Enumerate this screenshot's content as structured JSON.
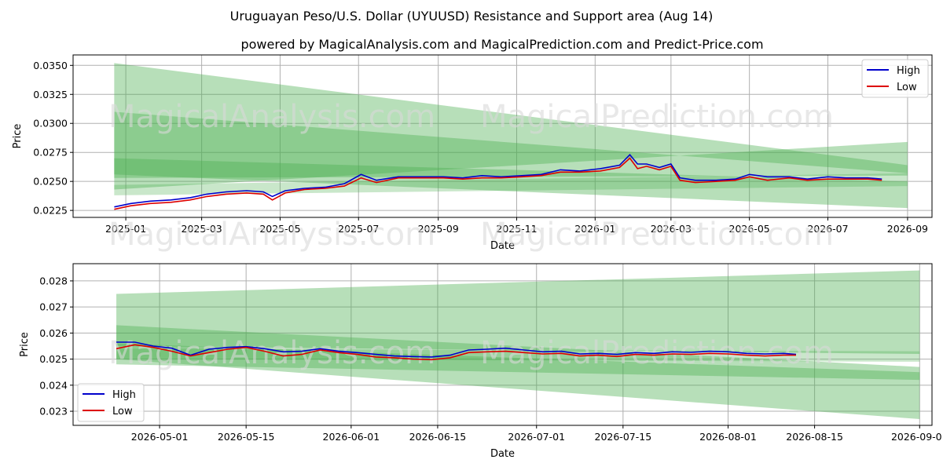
{
  "title": "Uruguayan Peso/U.S. Dollar (UYUUSD) Resistance and Support area (Aug 14)",
  "subtitle": "powered by MagicalAnalysis.com and MagicalPrediction.com and Predict-Price.com",
  "watermarks": [
    "MagicalAnalysis.com",
    "MagicalPrediction.com"
  ],
  "colors": {
    "high": "#0000cc",
    "low": "#dd0000",
    "band": "#4caf50",
    "grid": "#b0b0b0"
  },
  "chart_data": [
    {
      "type": "line",
      "xlabel": "Date",
      "ylabel": "Price",
      "xlim": [
        "2024-11-21",
        "2026-09-20"
      ],
      "ylim": [
        0.0219,
        0.0359
      ],
      "grid": true,
      "legend": "top-right",
      "x_ticks": [
        {
          "date": "2025-01-01",
          "label": "2025-01"
        },
        {
          "date": "2025-03-01",
          "label": "2025-03"
        },
        {
          "date": "2025-05-01",
          "label": "2025-05"
        },
        {
          "date": "2025-07-01",
          "label": "2025-07"
        },
        {
          "date": "2025-09-01",
          "label": "2025-09"
        },
        {
          "date": "2025-11-01",
          "label": "2025-11"
        },
        {
          "date": "2026-01-01",
          "label": "2026-01"
        },
        {
          "date": "2026-03-01",
          "label": "2026-03"
        },
        {
          "date": "2026-05-01",
          "label": "2026-05"
        },
        {
          "date": "2026-07-01",
          "label": "2026-07"
        },
        {
          "date": "2026-09-01",
          "label": "2026-09"
        }
      ],
      "y_ticks": [
        {
          "value": 0.0225,
          "label": "0.0225"
        },
        {
          "value": 0.025,
          "label": "0.0250"
        },
        {
          "value": 0.0275,
          "label": "0.0275"
        },
        {
          "value": 0.03,
          "label": "0.0300"
        },
        {
          "value": 0.0325,
          "label": "0.0325"
        },
        {
          "value": 0.035,
          "label": "0.0350"
        }
      ],
      "bands": [
        {
          "x": [
            "2024-12-23",
            "2026-09-01"
          ],
          "upper": [
            0.0352,
            0.0264
          ],
          "lower": [
            0.0253,
            0.0255
          ],
          "opacity": 0.4
        },
        {
          "x": [
            "2024-12-23",
            "2026-09-01"
          ],
          "upper": [
            0.031,
            0.0257
          ],
          "lower": [
            0.0243,
            0.0284
          ],
          "opacity": 0.4
        },
        {
          "x": [
            "2024-12-23",
            "2026-09-01"
          ],
          "upper": [
            0.027,
            0.025
          ],
          "lower": [
            0.0256,
            0.0227
          ],
          "opacity": 0.4
        },
        {
          "x": [
            "2024-12-23",
            "2026-09-01"
          ],
          "upper": [
            0.0247,
            0.0257
          ],
          "lower": [
            0.0238,
            0.0246
          ],
          "opacity": 0.3
        }
      ],
      "series": [
        {
          "name": "High",
          "x": [
            "2024-12-23",
            "2025-01-05",
            "2025-01-20",
            "2025-02-05",
            "2025-02-20",
            "2025-03-05",
            "2025-03-20",
            "2025-04-05",
            "2025-04-18",
            "2025-04-25",
            "2025-05-05",
            "2025-05-20",
            "2025-06-05",
            "2025-06-20",
            "2025-07-03",
            "2025-07-15",
            "2025-08-01",
            "2025-08-20",
            "2025-09-05",
            "2025-09-20",
            "2025-10-05",
            "2025-10-20",
            "2025-11-05",
            "2025-11-20",
            "2025-12-05",
            "2025-12-20",
            "2026-01-05",
            "2026-01-20",
            "2026-01-28",
            "2026-02-03",
            "2026-02-10",
            "2026-02-20",
            "2026-03-01",
            "2026-03-08",
            "2026-03-20",
            "2026-04-05",
            "2026-04-20",
            "2026-05-01",
            "2026-05-15",
            "2026-06-01",
            "2026-06-15",
            "2026-07-01",
            "2026-07-15",
            "2026-08-01",
            "2026-08-12"
          ],
          "values": [
            0.0228,
            0.0231,
            0.0233,
            0.0234,
            0.0236,
            0.0239,
            0.0241,
            0.0242,
            0.0241,
            0.0237,
            0.0242,
            0.0244,
            0.0245,
            0.0248,
            0.0256,
            0.0251,
            0.0254,
            0.0254,
            0.0254,
            0.0253,
            0.0255,
            0.0254,
            0.0255,
            0.0256,
            0.026,
            0.0259,
            0.0261,
            0.0264,
            0.0273,
            0.0265,
            0.0265,
            0.0262,
            0.0265,
            0.0253,
            0.0251,
            0.0251,
            0.0252,
            0.0256,
            0.0254,
            0.0254,
            0.0252,
            0.0254,
            0.0253,
            0.0253,
            0.0252
          ]
        },
        {
          "name": "Low",
          "x": [
            "2024-12-23",
            "2025-01-05",
            "2025-01-20",
            "2025-02-05",
            "2025-02-20",
            "2025-03-05",
            "2025-03-20",
            "2025-04-05",
            "2025-04-18",
            "2025-04-25",
            "2025-05-05",
            "2025-05-20",
            "2025-06-05",
            "2025-06-20",
            "2025-07-03",
            "2025-07-15",
            "2025-08-01",
            "2025-08-20",
            "2025-09-05",
            "2025-09-20",
            "2025-10-05",
            "2025-10-20",
            "2025-11-05",
            "2025-11-20",
            "2025-12-05",
            "2025-12-20",
            "2026-01-05",
            "2026-01-20",
            "2026-01-28",
            "2026-02-03",
            "2026-02-10",
            "2026-02-20",
            "2026-03-01",
            "2026-03-08",
            "2026-03-20",
            "2026-04-05",
            "2026-04-20",
            "2026-05-01",
            "2026-05-15",
            "2026-06-01",
            "2026-06-15",
            "2026-07-01",
            "2026-07-15",
            "2026-08-01",
            "2026-08-12"
          ],
          "values": [
            0.0226,
            0.0229,
            0.0231,
            0.0232,
            0.0234,
            0.0237,
            0.0239,
            0.024,
            0.0239,
            0.0234,
            0.024,
            0.0243,
            0.0244,
            0.0246,
            0.0253,
            0.0249,
            0.0253,
            0.0253,
            0.0253,
            0.0252,
            0.0253,
            0.0253,
            0.0254,
            0.0255,
            0.0258,
            0.0258,
            0.0259,
            0.0262,
            0.027,
            0.0261,
            0.0263,
            0.026,
            0.0263,
            0.0251,
            0.0249,
            0.025,
            0.0251,
            0.0254,
            0.0251,
            0.0253,
            0.0251,
            0.0252,
            0.0252,
            0.0252,
            0.0251
          ]
        }
      ]
    },
    {
      "type": "line",
      "xlabel": "Date",
      "ylabel": "Price",
      "xlim": [
        "2026-04-17",
        "2026-09-03"
      ],
      "ylim": [
        0.02246,
        0.02866
      ],
      "grid": true,
      "legend": "bottom-left",
      "x_ticks": [
        {
          "date": "2026-05-01",
          "label": "2026-05-01"
        },
        {
          "date": "2026-05-15",
          "label": "2026-05-15"
        },
        {
          "date": "2026-06-01",
          "label": "2026-06-01"
        },
        {
          "date": "2026-06-15",
          "label": "2026-06-15"
        },
        {
          "date": "2026-07-01",
          "label": "2026-07-01"
        },
        {
          "date": "2026-07-15",
          "label": "2026-07-15"
        },
        {
          "date": "2026-08-01",
          "label": "2026-08-01"
        },
        {
          "date": "2026-08-15",
          "label": "2026-08-15"
        },
        {
          "date": "2026-09-01",
          "label": "2026-09-01"
        }
      ],
      "y_ticks": [
        {
          "value": 0.023,
          "label": "0.023"
        },
        {
          "value": 0.024,
          "label": "0.024"
        },
        {
          "value": 0.025,
          "label": "0.025"
        },
        {
          "value": 0.026,
          "label": "0.026"
        },
        {
          "value": 0.027,
          "label": "0.027"
        },
        {
          "value": 0.028,
          "label": "0.028"
        }
      ],
      "bands": [
        {
          "x": [
            "2026-04-24",
            "2026-09-01"
          ],
          "upper": [
            0.0275,
            0.0284
          ],
          "lower": [
            0.0255,
            0.0252
          ],
          "opacity": 0.4
        },
        {
          "x": [
            "2026-04-24",
            "2026-09-01"
          ],
          "upper": [
            0.0263,
            0.0247
          ],
          "lower": [
            0.025,
            0.0227
          ],
          "opacity": 0.4
        },
        {
          "x": [
            "2026-04-24",
            "2026-09-01"
          ],
          "upper": [
            0.0256,
            0.0245
          ],
          "lower": [
            0.0248,
            0.0242
          ],
          "opacity": 0.4
        },
        {
          "x": [
            "2026-04-24",
            "2026-09-01"
          ],
          "upper": [
            0.0254,
            0.0253
          ],
          "lower": [
            0.025,
            0.0249
          ],
          "opacity": 0.3
        }
      ],
      "series": [
        {
          "name": "High",
          "x": [
            "2026-04-24",
            "2026-04-27",
            "2026-04-30",
            "2026-05-03",
            "2026-05-06",
            "2026-05-09",
            "2026-05-12",
            "2026-05-15",
            "2026-05-18",
            "2026-05-21",
            "2026-05-24",
            "2026-05-27",
            "2026-05-30",
            "2026-06-02",
            "2026-06-05",
            "2026-06-08",
            "2026-06-11",
            "2026-06-14",
            "2026-06-17",
            "2026-06-20",
            "2026-06-23",
            "2026-06-26",
            "2026-06-29",
            "2026-07-02",
            "2026-07-05",
            "2026-07-08",
            "2026-07-11",
            "2026-07-14",
            "2026-07-17",
            "2026-07-20",
            "2026-07-23",
            "2026-07-26",
            "2026-07-29",
            "2026-08-01",
            "2026-08-04",
            "2026-08-07",
            "2026-08-10",
            "2026-08-12"
          ],
          "values": [
            0.02565,
            0.02565,
            0.0255,
            0.02542,
            0.02515,
            0.02538,
            0.02545,
            0.02548,
            0.0254,
            0.02528,
            0.0253,
            0.0254,
            0.0253,
            0.02525,
            0.02518,
            0.02512,
            0.0251,
            0.02508,
            0.02515,
            0.02535,
            0.02538,
            0.02542,
            0.02535,
            0.02528,
            0.0253,
            0.0252,
            0.02522,
            0.02518,
            0.02525,
            0.02522,
            0.02528,
            0.02526,
            0.0253,
            0.02528,
            0.02522,
            0.0252,
            0.02522,
            0.02518
          ]
        },
        {
          "name": "Low",
          "x": [
            "2026-04-24",
            "2026-04-27",
            "2026-04-30",
            "2026-05-03",
            "2026-05-06",
            "2026-05-09",
            "2026-05-12",
            "2026-05-15",
            "2026-05-18",
            "2026-05-21",
            "2026-05-24",
            "2026-05-27",
            "2026-05-30",
            "2026-06-02",
            "2026-06-05",
            "2026-06-08",
            "2026-06-11",
            "2026-06-14",
            "2026-06-17",
            "2026-06-20",
            "2026-06-23",
            "2026-06-26",
            "2026-06-29",
            "2026-07-02",
            "2026-07-05",
            "2026-07-08",
            "2026-07-11",
            "2026-07-14",
            "2026-07-17",
            "2026-07-20",
            "2026-07-23",
            "2026-07-26",
            "2026-07-29",
            "2026-08-01",
            "2026-08-04",
            "2026-08-07",
            "2026-08-10",
            "2026-08-12"
          ],
          "values": [
            0.0254,
            0.02555,
            0.02545,
            0.0253,
            0.02512,
            0.02525,
            0.02538,
            0.02545,
            0.0253,
            0.02512,
            0.02518,
            0.02535,
            0.02525,
            0.02518,
            0.02508,
            0.02505,
            0.025,
            0.02498,
            0.02505,
            0.02525,
            0.02528,
            0.0253,
            0.02525,
            0.0252,
            0.02522,
            0.02512,
            0.02515,
            0.0251,
            0.02518,
            0.02515,
            0.0252,
            0.02518,
            0.02522,
            0.0252,
            0.02515,
            0.02512,
            0.02515,
            0.02515
          ]
        }
      ]
    }
  ]
}
